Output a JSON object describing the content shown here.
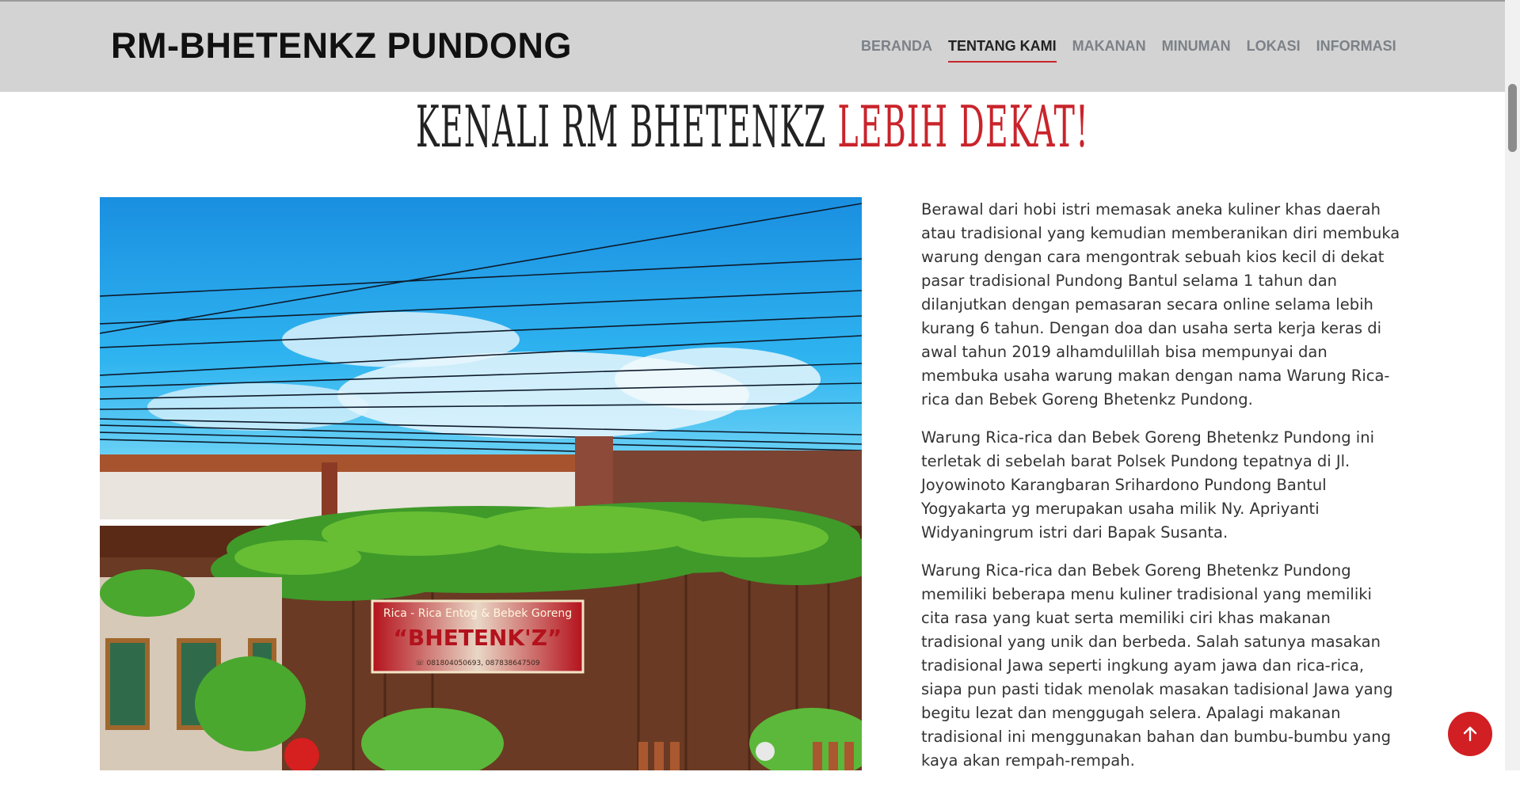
{
  "brand": "RM-BHETENKZ PUNDONG",
  "nav": [
    {
      "label": "BERANDA"
    },
    {
      "label": "TENTANG KAMI",
      "active": true
    },
    {
      "label": "MAKANAN"
    },
    {
      "label": "MINUMAN"
    },
    {
      "label": "LOKASI"
    },
    {
      "label": "INFORMASI"
    }
  ],
  "hero": {
    "title_part1": "KENALI RM BHETENKZ",
    "title_part2": "LEBIH DEKAT!"
  },
  "photo": {
    "sign_line1": "Rica - Rica Entog & Bebek Goreng",
    "sign_line2": "“BHETENK'Z”",
    "sign_line3": "☏ 081804050693, 087838647509"
  },
  "about": {
    "paragraphs": [
      "Berawal dari hobi istri memasak aneka kuliner khas daerah atau tradisional yang kemudian memberanikan diri membuka warung dengan cara mengontrak sebuah kios kecil di dekat pasar tradisional Pundong Bantul selama 1 tahun dan dilanjutkan dengan pemasaran secara online selama lebih kurang 6 tahun. Dengan doa dan usaha serta kerja keras di awal tahun 2019 alhamdulillah bisa mempunyai dan membuka usaha warung makan dengan nama Warung Rica-rica dan Bebek Goreng Bhetenkz Pundong.",
      "Warung Rica-rica dan Bebek Goreng Bhetenkz Pundong ini terletak di sebelah barat Polsek Pundong tepatnya di Jl. Joyowinoto Karangbaran Srihardono Pundong Bantul Yogyakarta yg merupakan usaha milik Ny. Apriyanti Widyaningrum istri dari Bapak Susanta.",
      "Warung Rica-rica dan Bebek Goreng Bhetenkz Pundong memiliki beberapa menu kuliner tradisional yang memiliki cita rasa yang kuat serta memiliki ciri khas makanan tradisional yang unik dan berbeda. Salah satunya masakan tradisional Jawa seperti ingkung ayam jawa dan rica-rica, siapa pun pasti tidak menolak masakan tadisional Jawa yang begitu lezat dan menggugah selera. Apalagi makanan tradisional ini menggunakan bahan dan bumbu-bumbu yang kaya akan rempah-rempah."
    ]
  },
  "back_to_top_icon": "arrow-up-icon",
  "colors": {
    "accent": "#c9242b",
    "header_bg": "#d3d3d3",
    "nav_text": "#7c8188"
  }
}
